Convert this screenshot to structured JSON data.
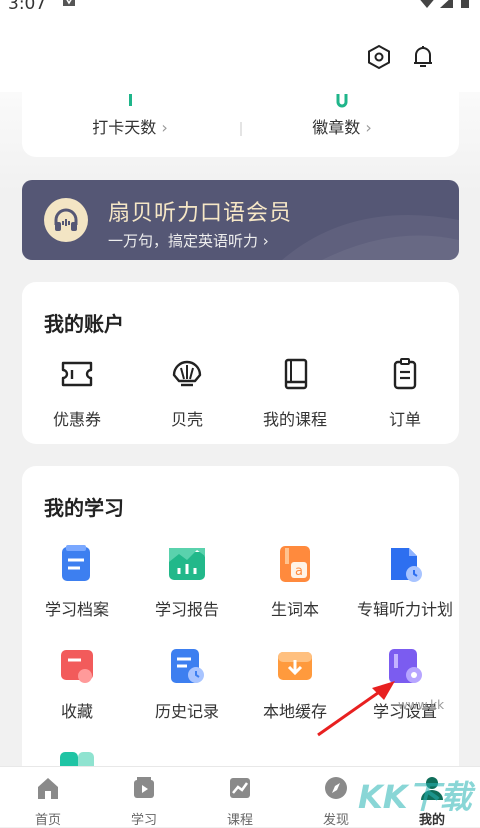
{
  "status": {
    "time": "3:07"
  },
  "stats": [
    {
      "label": "打卡天数",
      "chev": "›"
    },
    {
      "label": "徽章数",
      "chev": "›"
    }
  ],
  "vip": {
    "title": "扇贝听力口语会员",
    "subtitle": "一万句，搞定英语听力 ›"
  },
  "account": {
    "title": "我的账户",
    "items": [
      {
        "label": "优惠券",
        "icon": "coupon-icon"
      },
      {
        "label": "贝壳",
        "icon": "shell-icon"
      },
      {
        "label": "我的课程",
        "icon": "book-icon"
      },
      {
        "label": "订单",
        "icon": "clipboard-icon"
      }
    ]
  },
  "study": {
    "title": "我的学习",
    "items": [
      {
        "label": "学习档案",
        "icon": "study-archive-icon"
      },
      {
        "label": "学习报告",
        "icon": "study-report-icon"
      },
      {
        "label": "生词本",
        "icon": "vocabulary-book-icon"
      },
      {
        "label": "专辑听力计划",
        "icon": "album-plan-icon"
      },
      {
        "label": "收藏",
        "icon": "favorites-icon"
      },
      {
        "label": "历史记录",
        "icon": "history-icon"
      },
      {
        "label": "本地缓存",
        "icon": "local-cache-icon"
      },
      {
        "label": "学习设置",
        "icon": "study-settings-icon"
      }
    ]
  },
  "tabs": [
    {
      "label": "首页",
      "icon": "home-icon"
    },
    {
      "label": "学习",
      "icon": "study-icon"
    },
    {
      "label": "课程",
      "icon": "course-icon"
    },
    {
      "label": "发现",
      "icon": "discover-icon"
    },
    {
      "label": "我的",
      "icon": "profile-icon"
    }
  ],
  "watermark": {
    "big": "KK下载",
    "small": "www.kk"
  },
  "colors": {
    "vip_bg": "#555775",
    "vip_gold": "#f6e7c6",
    "accent_green": "#1fb58a",
    "active_tab": "#0f6e5a",
    "arrow_red": "#e82020"
  }
}
